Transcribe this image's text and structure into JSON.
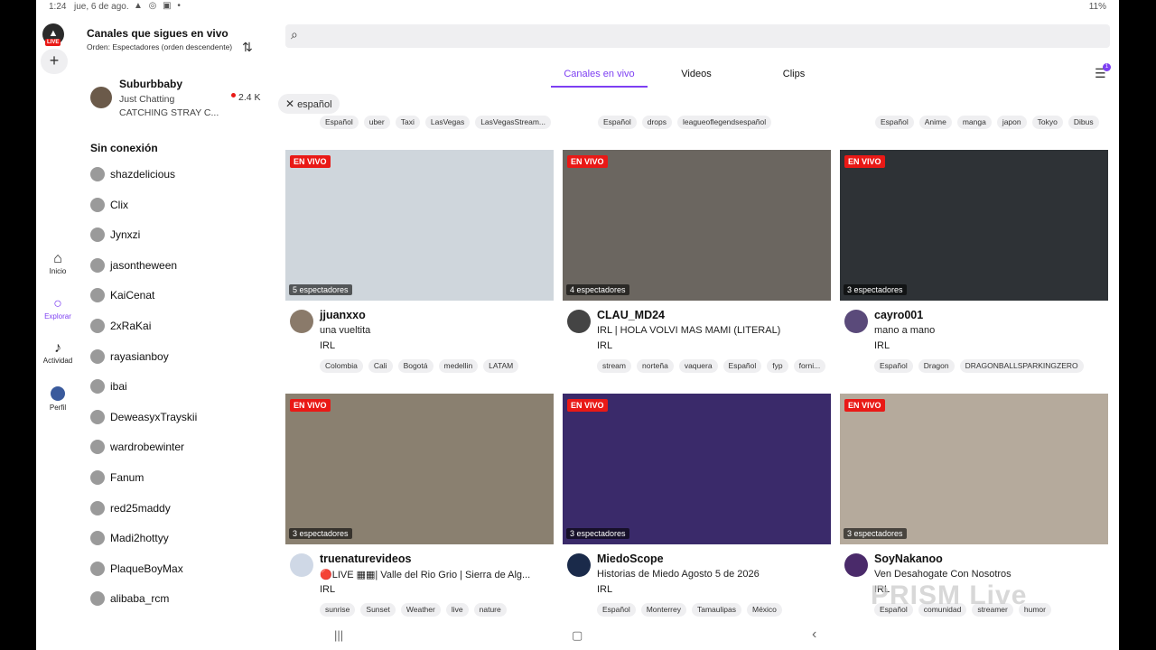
{
  "statusbar": {
    "time": "1:24",
    "date": "jue, 6 de ago.",
    "icons": "▲ ◎ ▣ •",
    "right": "11%"
  },
  "rail": {
    "live_badge": "LIVE",
    "add_label": "+",
    "items": [
      {
        "label": "Inicio",
        "icon": "home-icon"
      },
      {
        "label": "Explorar",
        "icon": "explore-icon"
      },
      {
        "label": "Actividad",
        "icon": "bell-icon"
      },
      {
        "label": "Perfil",
        "icon": "avatar"
      }
    ]
  },
  "following": {
    "title": "Canales que sigues en vivo",
    "order": "Orden: Espectadores (orden descendente)",
    "live": {
      "name": "Suburbbaby",
      "category": "Just Chatting",
      "title": "CATCHING STRAY C...",
      "viewers": "2.4 K"
    },
    "offline_title": "Sin conexión",
    "offline": [
      "shazdelicious",
      "Clix",
      "Jynxzi",
      "jasontheween",
      "KaiCenat",
      "2xRaKai",
      "rayasianboy",
      "ibai",
      "DeweasyxTrayskii",
      "wardrobewinter",
      "Fanum",
      "red25maddy",
      "Madi2hottyy",
      "PlaqueBoyMax",
      "alibaba_rcm"
    ]
  },
  "search": {
    "placeholder": ""
  },
  "tabs": [
    "Canales en vivo",
    "Videos",
    "Clips"
  ],
  "filter_badge": "1",
  "lang_chip": "español",
  "top_tags": [
    [
      "Español",
      "uber",
      "Taxi",
      "LasVegas",
      "LasVegasStream..."
    ],
    [
      "Español",
      "drops",
      "leagueoflegendsespañol"
    ],
    [
      "Español",
      "Anime",
      "manga",
      "japon",
      "Tokyo",
      "Dibus"
    ]
  ],
  "live_badge": "EN VIVO",
  "cards": [
    {
      "viewers": "5 espectadores",
      "name": "jjuanxxo",
      "title": "una vueltita",
      "category": "IRL",
      "tags": [
        "Colombia",
        "Cali",
        "Bogotá",
        "medellin",
        "LATAM"
      ],
      "avatar_color": "#8a7a6a",
      "thumb": "#cfd6dc"
    },
    {
      "viewers": "4 espectadores",
      "name": "CLAU_MD24",
      "title": "IRL | HOLA VOLVI MAS MAMI (LITERAL)",
      "category": "IRL",
      "tags": [
        "stream",
        "norteña",
        "vaquera",
        "Español",
        "fyp",
        "forni..."
      ],
      "avatar_color": "#444444",
      "thumb": "#6b6660"
    },
    {
      "viewers": "3 espectadores",
      "name": "cayro001",
      "title": "mano a mano",
      "category": "IRL",
      "tags": [
        "Español",
        "Dragon",
        "DRAGONBALLSPARKINGZERO"
      ],
      "avatar_color": "#5a4a7a",
      "thumb": "#2e3236"
    },
    {
      "viewers": "3 espectadores",
      "name": "truenaturevideos",
      "title": "🔴LIVE ▦▦| Valle del Rio Grio | Sierra de Alg...",
      "category": "IRL",
      "tags": [
        "sunrise",
        "Sunset",
        "Weather",
        "live",
        "nature"
      ],
      "avatar_color": "#cfd8e6",
      "thumb": "#8a8070"
    },
    {
      "viewers": "3 espectadores",
      "name": "MiedoScope",
      "title": "Historias de Miedo Agosto 5 de 2026",
      "category": "IRL",
      "tags": [
        "Español",
        "Monterrey",
        "Tamaulipas",
        "México"
      ],
      "avatar_color": "#1a2a4a",
      "thumb": "#3a2a6a"
    },
    {
      "viewers": "3 espectadores",
      "name": "SoyNakanoo",
      "title": "Ven Desahogate Con Nosotros",
      "category": "IRL",
      "tags": [
        "Español",
        "comunidad",
        "streamer",
        "humor"
      ],
      "avatar_color": "#4a2a6a",
      "thumb": "#b5aa9c"
    }
  ],
  "watermark": "PRISM Live",
  "navbar": {
    "recent": "|||",
    "home": "▢",
    "back": "‹"
  }
}
